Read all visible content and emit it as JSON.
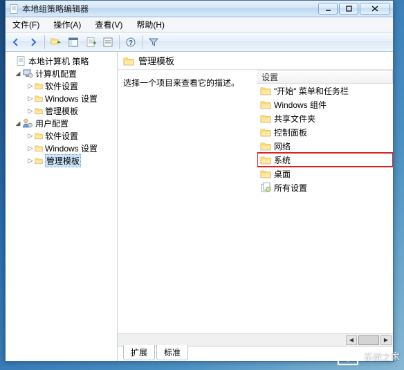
{
  "title": "本地组策略编辑器",
  "menu": {
    "file": "文件(F)",
    "action": "操作(A)",
    "view": "查看(V)",
    "help": "帮助(H)"
  },
  "tree": {
    "root": "本地计算机 策略",
    "comp": "计算机配置",
    "comp_sw": "软件设置",
    "comp_win": "Windows 设置",
    "comp_admin": "管理模板",
    "user": "用户配置",
    "user_sw": "软件设置",
    "user_win": "Windows 设置",
    "user_admin": "管理模板"
  },
  "content": {
    "heading": "管理模板",
    "desc": "选择一个项目来查看它的描述。",
    "col": "设置",
    "items": {
      "start": "\"开始\" 菜单和任务栏",
      "wincomp": "Windows 组件",
      "share": "共享文件夹",
      "cpl": "控制面板",
      "net": "网络",
      "sys": "系统",
      "desk": "桌面",
      "all": "所有设置"
    }
  },
  "tabs": {
    "ext": "扩展",
    "std": "标准"
  },
  "watermark": "系统之家"
}
